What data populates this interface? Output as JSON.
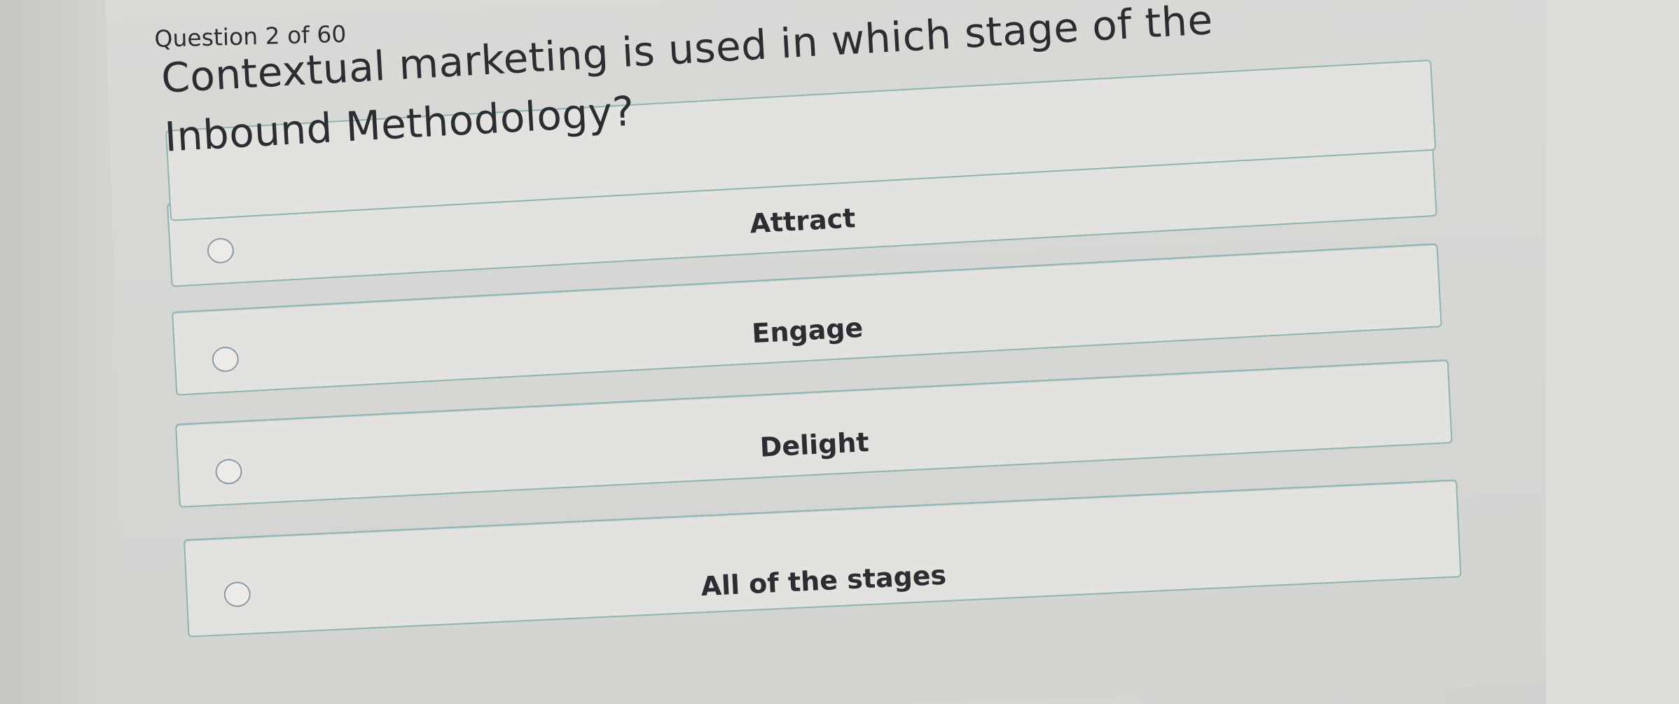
{
  "quiz": {
    "counter": "Question 2 of 60",
    "question": "Contextual marketing is used in which stage of the Inbound Methodology?",
    "options": [
      {
        "label": "Attract",
        "selected": false
      },
      {
        "label": "Engage",
        "selected": false
      },
      {
        "label": "Delight",
        "selected": false
      },
      {
        "label": "All of the stages",
        "selected": false
      }
    ]
  },
  "colors": {
    "option_border": "#8fb3b1",
    "option_background": "#e3e2de",
    "text": "#2a2e32"
  }
}
